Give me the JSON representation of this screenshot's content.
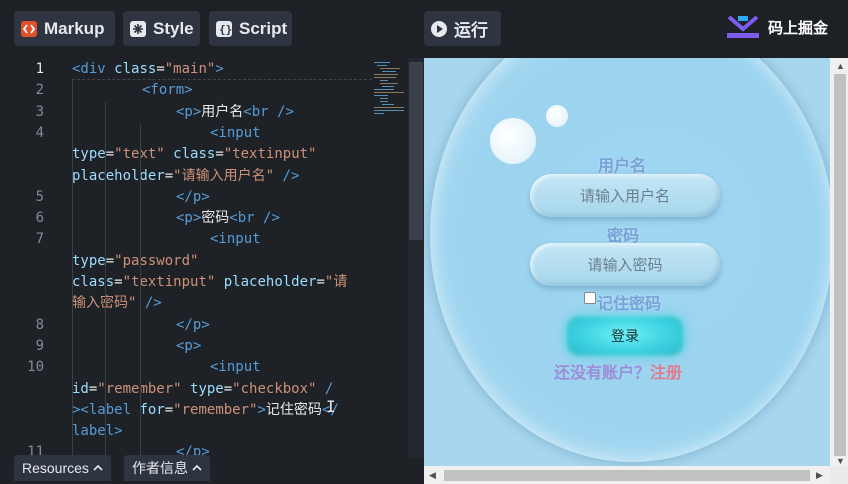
{
  "toolbar": {
    "markup_label": "Markup",
    "style_label": "Style",
    "script_label": "Script",
    "run_label": "运行",
    "brand_name": "码上掘金"
  },
  "editor": {
    "line_numbers": [
      "1",
      "2",
      "3",
      "4",
      "",
      "",
      "5",
      "6",
      "7",
      "",
      "",
      "",
      "8",
      "9",
      "10",
      "",
      "",
      ""
    ],
    "lines": [
      {
        "parts": [
          [
            "tag",
            "<div "
          ],
          [
            "att",
            "class"
          ],
          [
            "txt",
            "="
          ],
          [
            "str",
            "\"main\""
          ],
          [
            "tag",
            ">"
          ]
        ]
      },
      {
        "parts": [
          [
            "tag",
            "<form>"
          ]
        ]
      },
      {
        "parts": [
          [
            "tag",
            "<p>"
          ],
          [
            "txt",
            "用户名"
          ],
          [
            "tag",
            "<br />"
          ]
        ]
      },
      {
        "parts": [
          [
            "tag",
            "<input"
          ]
        ]
      },
      {
        "parts": [
          [
            "att",
            "type"
          ],
          [
            "txt",
            "="
          ],
          [
            "str",
            "\"text\" "
          ],
          [
            "att",
            "class"
          ],
          [
            "txt",
            "="
          ],
          [
            "str",
            "\"textinput\""
          ]
        ]
      },
      {
        "parts": [
          [
            "att",
            "placeholder"
          ],
          [
            "txt",
            "="
          ],
          [
            "str",
            "\"请输入用户名\" "
          ],
          [
            "tag",
            "/>"
          ]
        ]
      },
      {
        "parts": [
          [
            "tag",
            "</p>"
          ]
        ]
      },
      {
        "parts": [
          [
            "tag",
            "<p>"
          ],
          [
            "txt",
            "密码"
          ],
          [
            "tag",
            "<br />"
          ]
        ]
      },
      {
        "parts": [
          [
            "tag",
            "<input"
          ]
        ]
      },
      {
        "parts": [
          [
            "att",
            "type"
          ],
          [
            "txt",
            "="
          ],
          [
            "str",
            "\"password\""
          ]
        ]
      },
      {
        "parts": [
          [
            "att",
            "class"
          ],
          [
            "txt",
            "="
          ],
          [
            "str",
            "\"textinput\" "
          ],
          [
            "att",
            "placeholder"
          ],
          [
            "txt",
            "="
          ],
          [
            "str",
            "\"请"
          ]
        ]
      },
      {
        "parts": [
          [
            "str",
            "输入密码\" "
          ],
          [
            "tag",
            "/>"
          ]
        ]
      },
      {
        "parts": [
          [
            "tag",
            "</p>"
          ]
        ]
      },
      {
        "parts": [
          [
            "tag",
            "<p>"
          ]
        ]
      },
      {
        "parts": [
          [
            "tag",
            "<input"
          ]
        ]
      },
      {
        "parts": [
          [
            "att",
            "id"
          ],
          [
            "txt",
            "="
          ],
          [
            "str",
            "\"remember\" "
          ],
          [
            "att",
            "type"
          ],
          [
            "txt",
            "="
          ],
          [
            "str",
            "\"checkbox\" "
          ],
          [
            "tag",
            "/"
          ]
        ]
      },
      {
        "parts": [
          [
            "tag",
            "><label "
          ],
          [
            "att",
            "for"
          ],
          [
            "txt",
            "="
          ],
          [
            "str",
            "\"remember\""
          ],
          [
            "tag",
            ">"
          ],
          [
            "txt",
            "记住密码"
          ],
          [
            "tag",
            "</"
          ]
        ]
      },
      {
        "parts": [
          [
            "tag",
            "label>"
          ]
        ]
      }
    ],
    "last_line_number": "11",
    "last_line_code": "</p>"
  },
  "bottom": {
    "resources_label": "Resources",
    "author_label": "作者信息"
  },
  "preview": {
    "username_label": "用户名",
    "username_placeholder": "请输入用户名",
    "password_label": "密码",
    "password_placeholder": "请输入密码",
    "remember_label": "记住密码",
    "login_button": "登录",
    "no_account_text": "还没有账户？",
    "register_link": "注册"
  },
  "colors": {
    "accent_login": "#3ad0e0",
    "register_link": "#e07a8e",
    "label": "#7aa0d8"
  }
}
